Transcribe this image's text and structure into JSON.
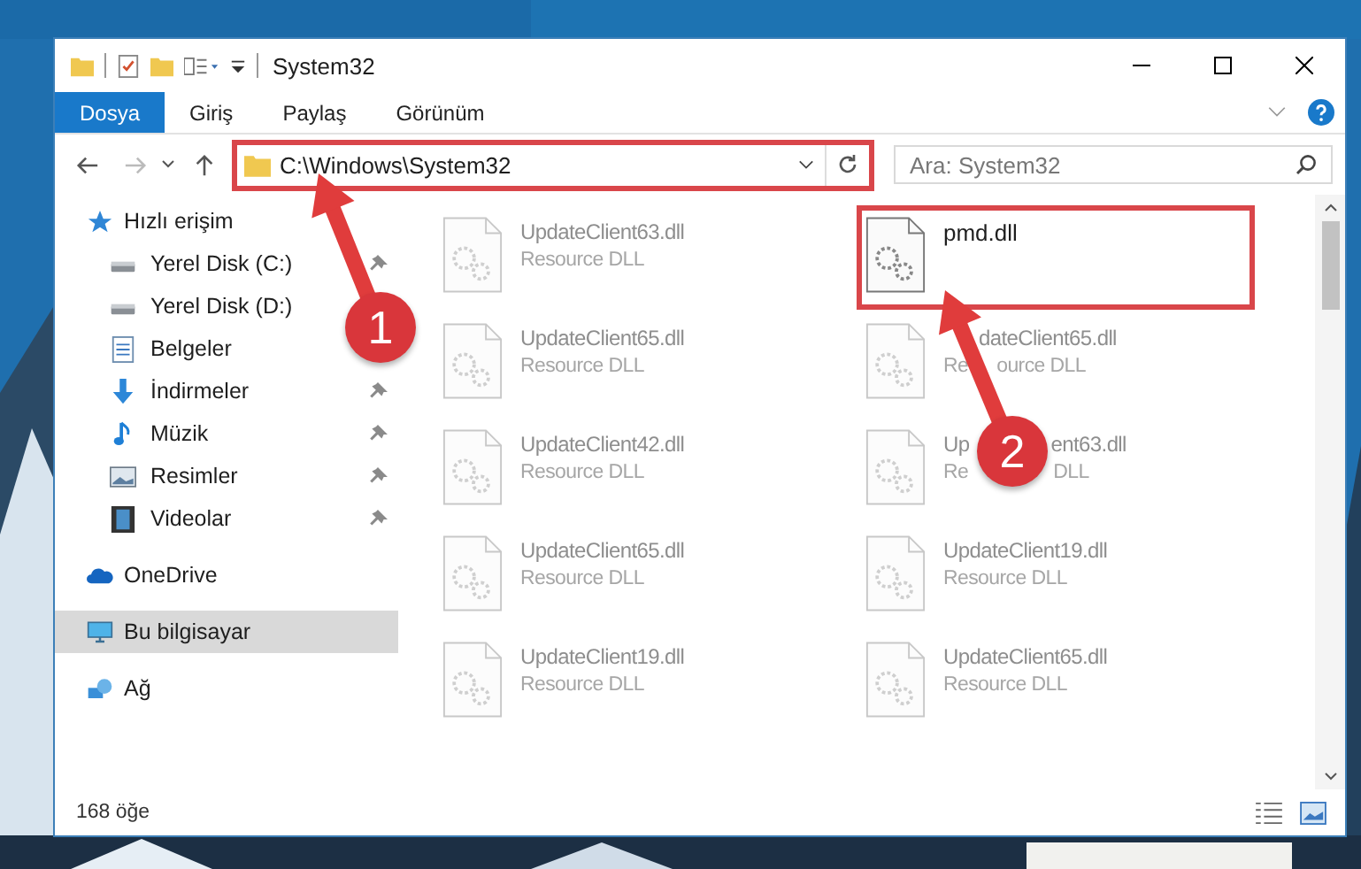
{
  "window": {
    "title": "System32"
  },
  "ribbon_tabs": [
    {
      "label": "Dosya",
      "selected": true
    },
    {
      "label": "Giriş",
      "selected": false
    },
    {
      "label": "Paylaş",
      "selected": false
    },
    {
      "label": "Görünüm",
      "selected": false
    }
  ],
  "address": {
    "path": "C:\\Windows\\System32",
    "annotated": true
  },
  "search": {
    "placeholder": "Ara: System32"
  },
  "sidebar": {
    "items": [
      {
        "label": "Hızlı erişim",
        "kind": "star",
        "selected": false,
        "children": [
          {
            "label": "Yerel Disk (C:)",
            "kind": "drive",
            "pinned": true,
            "selected": false
          },
          {
            "label": "Yerel Disk (D:)",
            "kind": "drive",
            "selected": false
          },
          {
            "label": "Belgeler",
            "kind": "documents",
            "selected": false
          },
          {
            "label": "İndirmeler",
            "kind": "downloads",
            "pinned": true,
            "selected": false
          },
          {
            "label": "Müzik",
            "kind": "music",
            "pinned": true,
            "selected": false
          },
          {
            "label": "Resimler",
            "kind": "pictures",
            "pinned": true,
            "selected": false
          },
          {
            "label": "Videolar",
            "kind": "videos",
            "pinned": true,
            "selected": false
          }
        ]
      },
      {
        "label": "OneDrive",
        "kind": "cloud",
        "selected": false
      },
      {
        "label": "Bu bilgisayar",
        "kind": "computer",
        "selected": true
      },
      {
        "label": "Ağ",
        "kind": "network",
        "selected": false
      }
    ]
  },
  "files": [
    {
      "name_parts": [
        "UpdateClient63.dll"
      ],
      "type_parts": [
        "Resource DLL"
      ],
      "blurred": true,
      "annotated": false
    },
    {
      "name_parts": [
        "pmd.dll"
      ],
      "blurred": false,
      "annotated": true
    },
    {
      "name_parts": [
        "UpdateClient65.dll"
      ],
      "type_parts": [
        "Resource DLL"
      ],
      "blurred": true,
      "annotated": false
    },
    {
      "name_parts": [
        "dateClient65.dll"
      ],
      "type_parts": [
        "Re",
        "ource DLL"
      ],
      "blurred": true,
      "annotated": false
    },
    {
      "name_parts": [
        "UpdateClient42.dll"
      ],
      "type_parts": [
        "Resource DLL"
      ],
      "blurred": true,
      "annotated": false
    },
    {
      "name_parts": [
        "Up",
        "ent63.dll"
      ],
      "type_parts": [
        "Re",
        "DLL"
      ],
      "blurred": true,
      "annotated": false
    },
    {
      "name_parts": [
        "UpdateClient65.dll"
      ],
      "type_parts": [
        "Resource DLL"
      ],
      "blurred": true,
      "annotated": false
    },
    {
      "name_parts": [
        "UpdateClient19.dll"
      ],
      "type_parts": [
        "Resource DLL"
      ],
      "blurred": true,
      "annotated": false
    },
    {
      "name_parts": [
        "UpdateClient19.dll"
      ],
      "type_parts": [
        "Resource DLL"
      ],
      "blurred": true,
      "annotated": false
    },
    {
      "name_parts": [
        "UpdateClient65.dll"
      ],
      "type_parts": [
        "Resource DLL"
      ],
      "blurred": true,
      "annotated": false
    }
  ],
  "status_bar": {
    "item_count": "168 öğe"
  },
  "annotations": [
    {
      "label": "1"
    },
    {
      "label": "2"
    }
  ]
}
